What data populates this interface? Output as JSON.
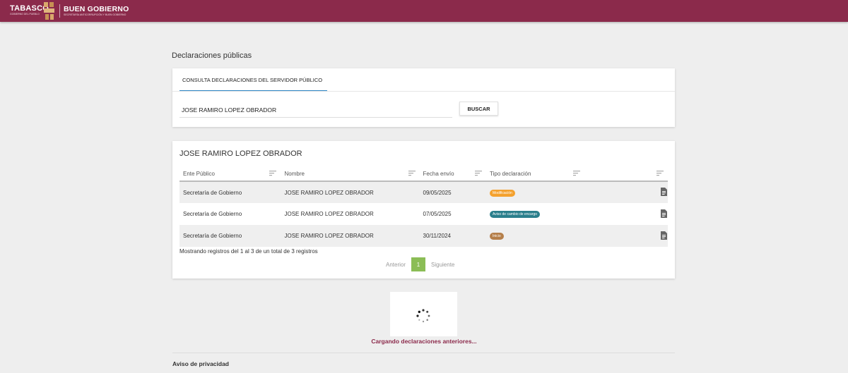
{
  "header": {
    "logo_main": "TABASCO",
    "logo_main_sub": "GOBIERNO DEL PUEBLO",
    "logo_secondary": "BUEN GOBIERNO",
    "logo_secondary_sub": "SECRETARÍA ANTICORRUPCIÓN Y BUEN GOBIERNO",
    "brand_color": "#8b2a4b"
  },
  "page": {
    "title": "Declaraciones públicas"
  },
  "search": {
    "tab_label": "CONSULTA DECLARACIONES DEL SERVIDOR PÚBLICO",
    "input_value": "JOSE RAMIRO LOPEZ OBRADOR",
    "button_label": "BUSCAR"
  },
  "results": {
    "title": "JOSE RAMIRO LOPEZ OBRADOR",
    "columns": [
      "Ente Público",
      "Nombre",
      "Fecha envío",
      "Tipo declaración",
      ""
    ],
    "rows": [
      {
        "ente": "Secretaría de Gobierno",
        "nombre": "JOSE RAMIRO LOPEZ OBRADOR",
        "fecha": "09/05/2025",
        "tipo": "Modificación",
        "tipo_color": "#f4a12e",
        "icon": "document-icon"
      },
      {
        "ente": "Secretaría de Gobierno",
        "nombre": "JOSE RAMIRO LOPEZ OBRADOR",
        "fecha": "07/05/2025",
        "tipo": "Aviso de cambio de encargo",
        "tipo_color": "#2b7f8c",
        "icon": "document-icon"
      },
      {
        "ente": "Secretaría de Gobierno",
        "nombre": "JOSE RAMIRO LOPEZ OBRADOR",
        "fecha": "30/11/2024",
        "tipo": "Inicio",
        "tipo_color": "#b57f4a",
        "icon": "document-icon"
      }
    ],
    "count_text": "Mostrando registros del 1 al 3 de un total de 3 registros",
    "pager": {
      "prev": "Anterior",
      "current": "1",
      "next": "Siguiente"
    }
  },
  "loader": {
    "text": "Cargando declaraciones anteriores..."
  },
  "footer": {
    "privacy": "Aviso de privacidad"
  }
}
